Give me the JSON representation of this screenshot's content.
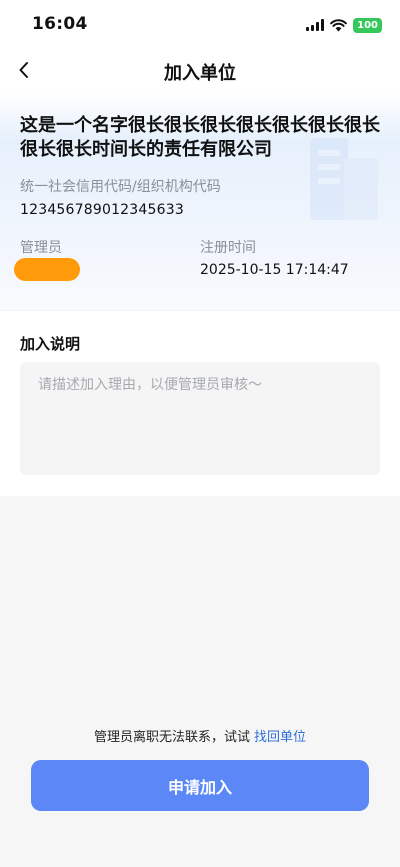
{
  "status_bar": {
    "time": "16:04",
    "battery": "100",
    "icons": [
      "signal-icon",
      "wifi-icon",
      "battery-icon"
    ]
  },
  "nav": {
    "title": "加入单位",
    "back_icon": "chevron-left-icon"
  },
  "company": {
    "name": "这是一个名字很长很长很长很长很长很长很长很长很长时间长的责任有限公司",
    "credit_code_label": "统一社会信用代码/组织机构代码",
    "credit_code": "123456789012345633",
    "admin_label": "管理员",
    "admin_name": "",
    "reg_time_label": "注册时间",
    "reg_time": "2025-10-15 17:14:47"
  },
  "join": {
    "section_title": "加入说明",
    "reason_value": "",
    "reason_placeholder": "请描述加入理由，以便管理员审核～"
  },
  "footer": {
    "recover_text": "管理员离职无法联系，试试",
    "recover_link": "找回单位",
    "apply_button": "申请加入"
  },
  "colors": {
    "accent": "#5b87f7",
    "link": "#2d6fd8",
    "admin_badge": "#ff9b0a",
    "battery": "#35c759"
  }
}
